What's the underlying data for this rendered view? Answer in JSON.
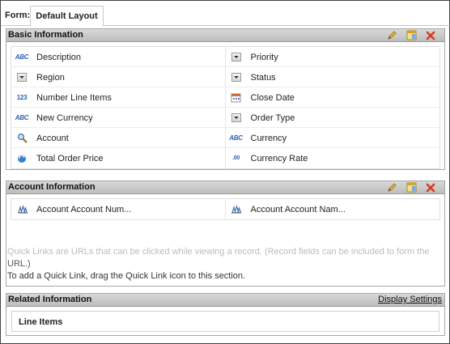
{
  "tabs": {
    "form_label": "Form:",
    "active_tab": "Default Layout"
  },
  "basic_section": {
    "title": "Basic Information",
    "rows": [
      [
        {
          "label": "Description",
          "icon": "abc-text-icon"
        },
        {
          "label": "Priority",
          "icon": "dropdown-icon"
        }
      ],
      [
        {
          "label": "Region",
          "icon": "dropdown-icon"
        },
        {
          "label": "Status",
          "icon": "dropdown-icon"
        }
      ],
      [
        {
          "label": "Number Line Items",
          "icon": "number-123-icon"
        },
        {
          "label": "Close Date",
          "icon": "calendar-icon"
        }
      ],
      [
        {
          "label": "New Currency",
          "icon": "abc-text-icon"
        },
        {
          "label": "Order Type",
          "icon": "dropdown-icon"
        }
      ],
      [
        {
          "label": "Account",
          "icon": "lookup-icon"
        },
        {
          "label": "Currency",
          "icon": "abc-text-icon"
        }
      ],
      [
        {
          "label": "Total Order Price",
          "icon": "formula-icon"
        },
        {
          "label": "Currency Rate",
          "icon": "decimal-icon"
        }
      ]
    ]
  },
  "account_section": {
    "title": "Account Information",
    "row": [
      {
        "label": "Account Account Num...",
        "icon": "related-field-icon"
      },
      {
        "label": "Account Account Nam...",
        "icon": "related-field-icon"
      }
    ]
  },
  "quick_links": {
    "line1": "Quick Links are URLs that can be clicked while viewing a record. (Record fields can be included to form the",
    "line2": "URL.)",
    "line3": "To add a Quick Link, drag the Quick Link icon to this section."
  },
  "related_section": {
    "title": "Related Information",
    "display_settings": "Display Settings",
    "item": "Line Items"
  },
  "icons": {
    "edit": "pencil-icon",
    "layout": "layout-icon",
    "delete": "close-x-icon"
  },
  "colors": {
    "header_bg": "#c9c9c9",
    "icon_blue": "#2c5fb3",
    "delete_red": "#d63c1f",
    "edit_yellow": "#e0a11b"
  }
}
